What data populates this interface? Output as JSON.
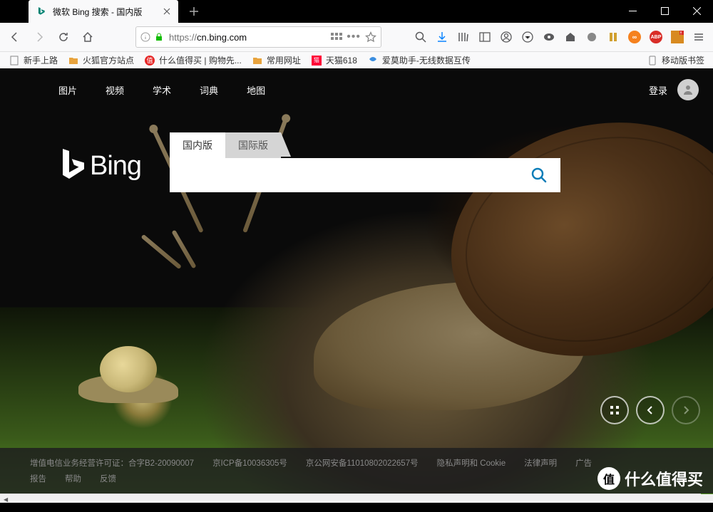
{
  "window": {
    "tab_title": "微软 Bing 搜索 - 国内版"
  },
  "toolbar": {
    "url_prefix": "https://",
    "url_domain": "cn.bing.com"
  },
  "bookmarks": {
    "items": [
      {
        "label": "新手上路",
        "icon": "page"
      },
      {
        "label": "火狐官方站点",
        "icon": "folder"
      },
      {
        "label": "什么值得买 | 购物先...",
        "icon": "smzdm"
      },
      {
        "label": "常用网址",
        "icon": "folder"
      },
      {
        "label": "天猫618",
        "icon": "tmall"
      },
      {
        "label": "爱莫助手-无线数据互传",
        "icon": "aimo"
      }
    ],
    "right": {
      "label": "移动版书签",
      "icon": "mobile"
    }
  },
  "bing": {
    "nav": [
      "图片",
      "视频",
      "学术",
      "词典",
      "地图"
    ],
    "login": "登录",
    "logo_text": "Bing",
    "tabs": {
      "domestic": "国内版",
      "intl": "国际版"
    },
    "search_placeholder": ""
  },
  "footer": {
    "row1": [
      "增值电信业务经营许可证：合字B2-20090007",
      "京ICP备10036305号",
      "京公网安备11010802022657号",
      "隐私声明和 Cookie",
      "法律声明",
      "广告"
    ],
    "row2": [
      "报告",
      "帮助",
      "反馈"
    ]
  },
  "watermark": {
    "badge": "值",
    "text": "什么值得买"
  }
}
